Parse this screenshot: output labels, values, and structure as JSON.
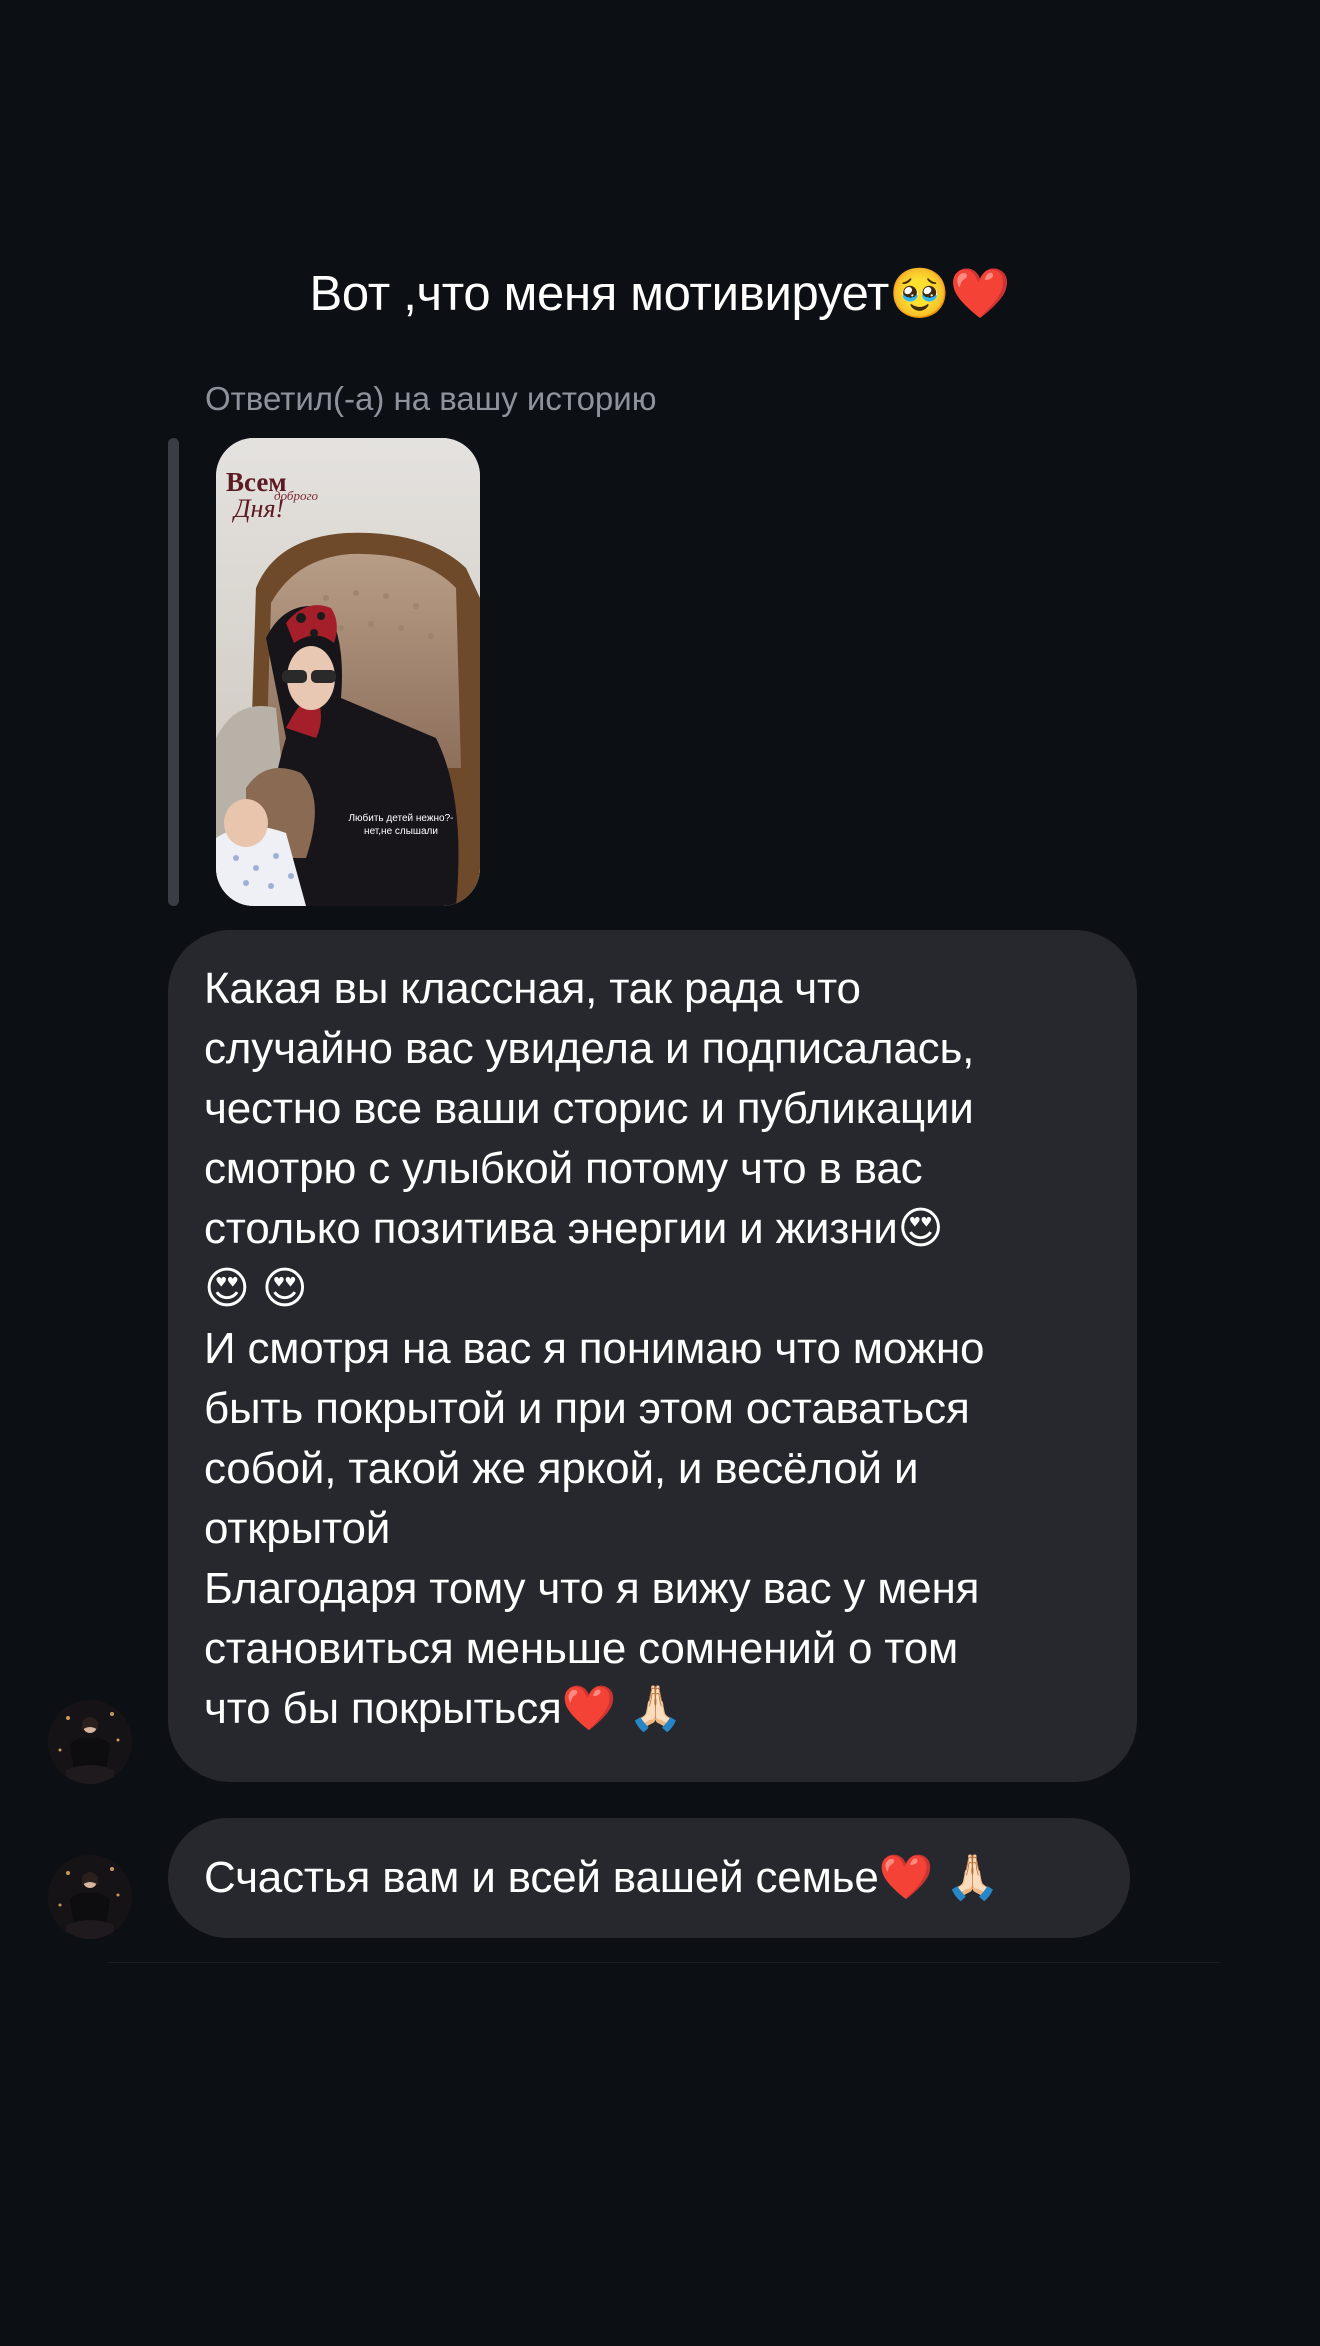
{
  "conversation": {
    "caption": "Вот ,что меня мотивирует🥹❤️",
    "reply_label": "Ответил(-а) на вашу историю",
    "story": {
      "title_line_1": "Всем",
      "title_line_2": "доброго",
      "title_line_3": "Дня!",
      "overlay_text": "Любить детей нежно?-\nнет,не слышали"
    },
    "messages": [
      {
        "text": "Какая вы классная, так рада что\nслучайно вас увидела и подписалась,\nчестно все ваши сторис и публикации\nсмотрю с улыбкой потому что в вас\nстолько позитива энергии и жизни😍\n😍 😍\nИ смотря на вас я понимаю что можно\nбыть покрытой и при этом оставаться\nсобой, такой же яркой, и весёлой и\nоткрытой\nБлагодаря тому что я вижу вас у меня\nстановиться меньше сомнений о том\nчто бы покрыться❤️ 🙏🏻"
      },
      {
        "text": "Счастья вам и всей вашей семье❤️ 🙏🏻"
      }
    ]
  },
  "colors": {
    "background": "#0c0f14",
    "bubble": "#26282d",
    "secondary_text": "#8e939b",
    "reply_bar": "#3a3d44"
  }
}
